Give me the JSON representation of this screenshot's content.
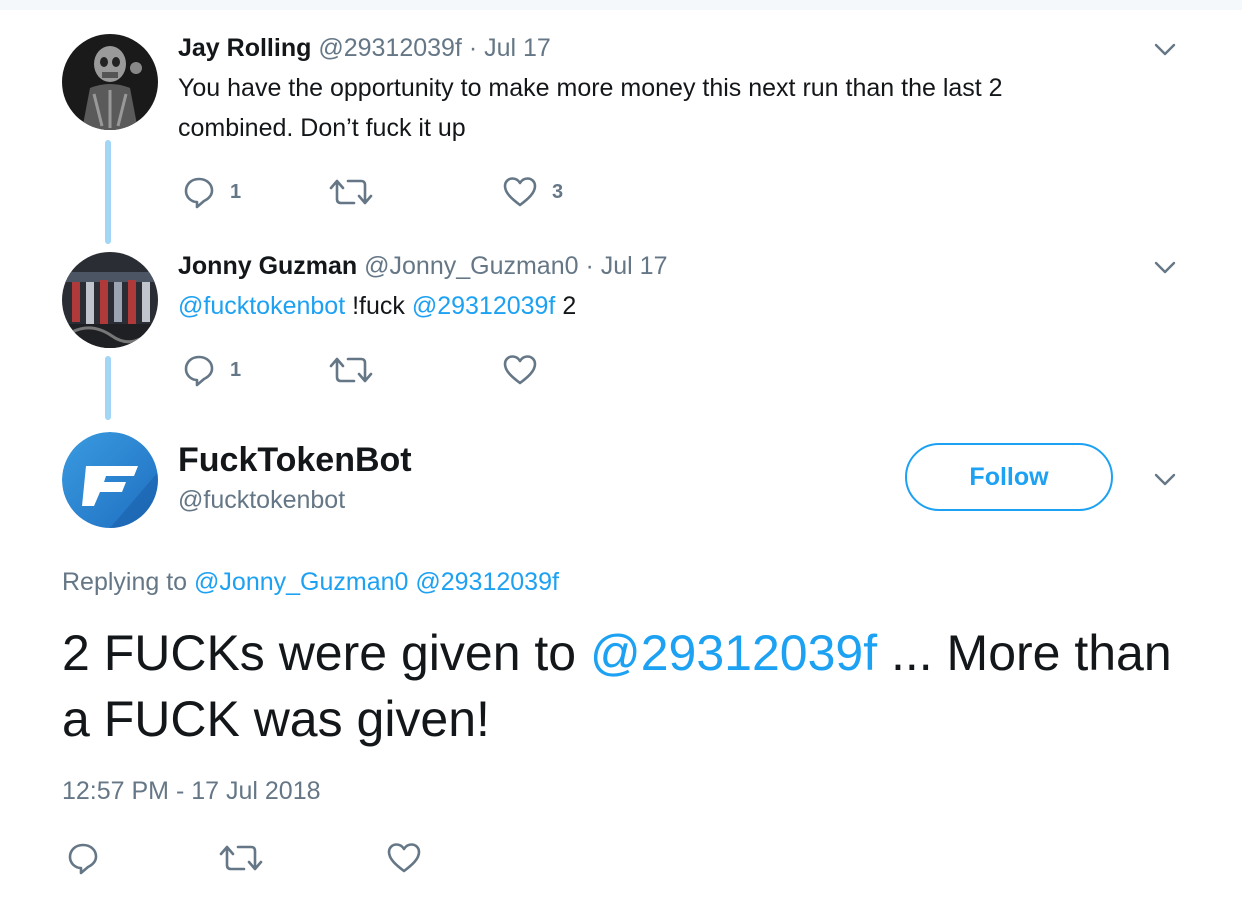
{
  "tweets": [
    {
      "name": "Jay Rolling",
      "handle": "@29312039f",
      "dot": "·",
      "date": "Jul 17",
      "text_line1": "You have the opportunity to make more money this next run than the last 2",
      "text_line2": "combined. Don’t fuck it up",
      "reply_count": "1",
      "like_count": "3"
    },
    {
      "name": "Jonny Guzman",
      "handle": "@Jonny_Guzman0",
      "dot": "·",
      "date": "Jul 17",
      "mention1": "@fucktokenbot",
      "text_mid": " !fuck ",
      "mention2": "@29312039f",
      "text_end": " 2",
      "reply_count": "1"
    }
  ],
  "main_tweet": {
    "name": "FuckTokenBot",
    "handle": "@fucktokenbot",
    "follow_label": "Follow",
    "replying_prefix": "Replying to",
    "replying_to_1": "@Jonny_Guzman0",
    "replying_to_2": "@29312039f",
    "text_part1": "2 FUCKs were given to ",
    "text_mention": "@29312039f",
    "text_part2": " ... More than a FUCK was given!",
    "timestamp": "12:57 PM - 17 Jul 2018"
  },
  "colors": {
    "accent": "#1da1f2",
    "muted": "#657786",
    "thread_line": "#a3d5f5"
  },
  "icons": [
    "reply-icon",
    "retweet-icon",
    "like-icon",
    "caret-down-icon",
    "fucktoken-logo-icon"
  ]
}
